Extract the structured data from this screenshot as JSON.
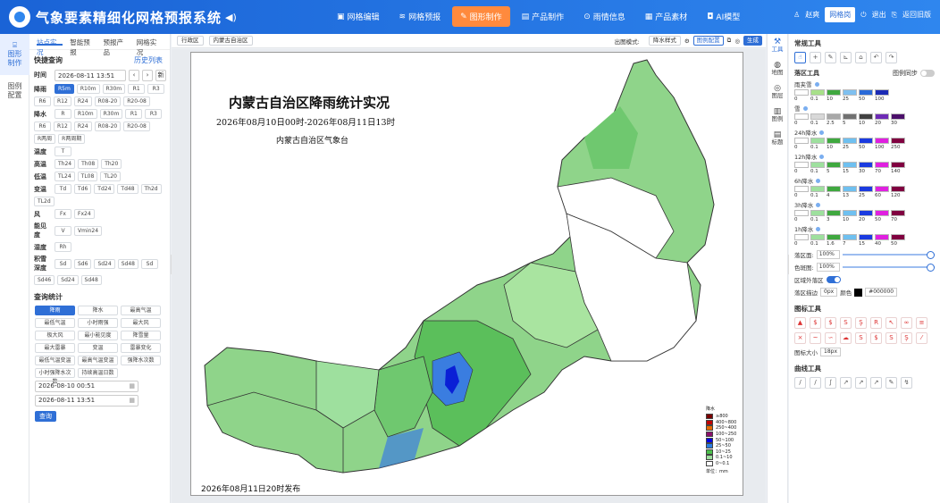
{
  "header": {
    "title": "气象要素精细化网格预报系统",
    "nav": [
      {
        "icon": "▣",
        "label": "网格编辑"
      },
      {
        "icon": "≋",
        "label": "网格预报"
      },
      {
        "icon": "✎",
        "label": "图形制作"
      },
      {
        "icon": "▤",
        "label": "产品制作"
      },
      {
        "icon": "⊙",
        "label": "雨情信息"
      },
      {
        "icon": "▦",
        "label": "产品素材"
      },
      {
        "icon": "◘",
        "label": "AI模型"
      }
    ],
    "user": "赵爽",
    "org": "网格岗",
    "logout": "退出",
    "back": "返回旧版"
  },
  "leftnav": [
    {
      "label": "图形\n制作"
    },
    {
      "label": "图例\n配置"
    }
  ],
  "left": {
    "tabs": [
      "站点实况",
      "智能预报",
      "预报产品",
      "网格实况"
    ],
    "quick_title": "快捷查询",
    "history_link": "历史列表",
    "time_label": "时间",
    "time_value": "2026-08-11 13:51",
    "rows": [
      {
        "label": "降雨",
        "items": [
          "R5m",
          "R10m",
          "R30m",
          "R1",
          "R3",
          "R6",
          "R12",
          "R24",
          "R08-20",
          "R20-08"
        ]
      },
      {
        "label": "降水",
        "items": [
          "R",
          "R10m",
          "R30m",
          "R1",
          "R3",
          "R6",
          "R12",
          "R24",
          "R08-20",
          "R20-08",
          "R两周",
          "R两周期"
        ]
      },
      {
        "label": "温度",
        "items": [
          "T"
        ]
      },
      {
        "label": "高温",
        "items": [
          "Th24",
          "Th08",
          "Th20"
        ]
      },
      {
        "label": "低温",
        "items": [
          "TL24",
          "TL08",
          "TL20"
        ]
      },
      {
        "label": "变温",
        "items": [
          "Td",
          "Td6",
          "Td24",
          "Td48",
          "Th2d",
          "TL2d"
        ]
      },
      {
        "label": "风",
        "items": [
          "Fx",
          "Fx24"
        ]
      },
      {
        "label": "能见度",
        "items": [
          "V",
          "Vmin24"
        ]
      },
      {
        "label": "湿度",
        "items": [
          "Rh"
        ]
      },
      {
        "label": "积雪深度",
        "items": [
          "Sd",
          "Sd6",
          "Sd24",
          "Sd48",
          "Sd",
          "Sd46",
          "Sd24",
          "Sd48"
        ]
      }
    ],
    "stats_title": "查询统计",
    "stats": [
      "降雨",
      "降水",
      "最高气温",
      "最低气温",
      "小时雨强",
      "最大风",
      "极大风",
      "最小能见度",
      "降雪量",
      "最大雷暴",
      "变温",
      "雷暴变化",
      "最低气温变温",
      "最高气温变温",
      "强降水次数",
      "小时强降水次数",
      "持续高温日数"
    ],
    "start": "2026-08-10 00:51",
    "end": "2026-08-11 13:51",
    "query_button": "查询"
  },
  "toolbar": {
    "region": "行政区",
    "product": "内蒙古自治区",
    "mode_label": "出图模式:",
    "mode": "降水样式",
    "legend_config": "图例配置",
    "generate": "生成"
  },
  "map": {
    "title": "内蒙古自治区降雨统计实况",
    "subtitle": "2026年08月10日00时-2026年08月11日13时",
    "agency": "内蒙古自治区气象台",
    "pubtime": "2026年08月11日20时发布",
    "legend_title": "降水",
    "legend_unit": "单位：mm",
    "legend": [
      {
        "label": "≥800",
        "color": "#7a0000"
      },
      {
        "label": "400~800",
        "color": "#c00000"
      },
      {
        "label": "250~400",
        "color": "#e86a00"
      },
      {
        "label": "100~250",
        "color": "#8a0f6a"
      },
      {
        "label": "50~100",
        "color": "#0000e6"
      },
      {
        "label": "25~50",
        "color": "#2a7de1"
      },
      {
        "label": "10~25",
        "color": "#4cc04c"
      },
      {
        "label": "0.1~10",
        "color": "#9ee09e"
      },
      {
        "label": "0~0.1",
        "color": "#ffffff"
      }
    ]
  },
  "rightbar": [
    "工具",
    "地图",
    "图层",
    "图例",
    "标题"
  ],
  "right": {
    "tools_title": "常规工具",
    "fill_title": "落区工具",
    "sync_label": "图例同步",
    "scales": [
      {
        "name": "雨夹雪",
        "colors": [
          "#ffffff",
          "#a8e08a",
          "#3fa83f",
          "#7fc0f0",
          "#2a6ad8",
          "#1b2bb5"
        ],
        "values": [
          "0",
          "0.1",
          "10",
          "25",
          "50",
          "100"
        ]
      },
      {
        "name": "雪",
        "colors": [
          "#ffffff",
          "#d8d8d8",
          "#a8a8a8",
          "#707070",
          "#404040",
          "#6d2ab5",
          "#4b0f6a"
        ],
        "values": [
          "0",
          "0.1",
          "2.5",
          "5",
          "10",
          "20",
          "30"
        ]
      },
      {
        "name": "24h降水",
        "colors": [
          "#ffffff",
          "#9ee09e",
          "#3fa83f",
          "#6fc0f0",
          "#1b3be0",
          "#e020e0",
          "#800040"
        ],
        "values": [
          "0",
          "0.1",
          "10",
          "25",
          "50",
          "100",
          "250"
        ]
      },
      {
        "name": "12h降水",
        "colors": [
          "#ffffff",
          "#9ee09e",
          "#3fa83f",
          "#6fc0f0",
          "#1b3be0",
          "#e020e0",
          "#800040"
        ],
        "values": [
          "0",
          "0.1",
          "5",
          "15",
          "30",
          "70",
          "140"
        ]
      },
      {
        "name": "6h降水",
        "colors": [
          "#ffffff",
          "#9ee09e",
          "#3fa83f",
          "#6fc0f0",
          "#1b3be0",
          "#e020e0",
          "#800040"
        ],
        "values": [
          "0",
          "0.1",
          "4",
          "13",
          "25",
          "60",
          "120"
        ]
      },
      {
        "name": "3h降水",
        "colors": [
          "#ffffff",
          "#9ee09e",
          "#3fa83f",
          "#6fc0f0",
          "#1b3be0",
          "#e020e0",
          "#800040"
        ],
        "values": [
          "0",
          "0.1",
          "3",
          "10",
          "20",
          "50",
          "70"
        ]
      },
      {
        "name": "1h降水",
        "colors": [
          "#ffffff",
          "#9ee09e",
          "#3fa83f",
          "#6fc0f0",
          "#1b3be0",
          "#e020e0",
          "#800040"
        ],
        "values": [
          "0",
          "0.1",
          "1.6",
          "7",
          "15",
          "40",
          "50"
        ]
      }
    ],
    "fill_opacity_label": "落区面:",
    "fill_opacity": "100%",
    "line_opacity_label": "色斑图:",
    "line_opacity": "100%",
    "outside_label": "区域外落区",
    "extend_label": "落区描边",
    "extend_value": "0px",
    "color_label": "颜色",
    "color_value": "#000000",
    "icons_title": "图标工具",
    "font_label": "图标大小",
    "font_value": "18px",
    "curve_title": "曲线工具"
  }
}
